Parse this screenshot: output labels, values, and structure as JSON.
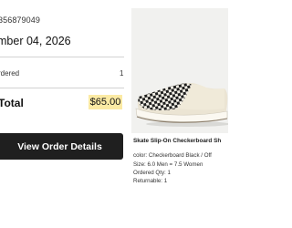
{
  "order": {
    "number": "356879049",
    "date": "mber 04, 2026",
    "quantity_label": "rdered",
    "quantity_value": "1",
    "total_label": "Total",
    "total_value": "$65.00",
    "view_button_label": "View Order Details"
  },
  "product": {
    "image_icon": "sneaker-image",
    "name": "Skate Slip-On Checkerboard Sh",
    "color_line": "color: Checkerboard Black / Off",
    "size_line": "Size: 6.0 Men = 7.5 Women",
    "ordered_qty_line": "Ordered Qty: 1",
    "returnable_line": "Returnable: 1"
  },
  "colors": {
    "button_bg": "#1f1f1f",
    "total_highlight": "#fbeaa4",
    "image_bg": "#f1f1ef"
  }
}
